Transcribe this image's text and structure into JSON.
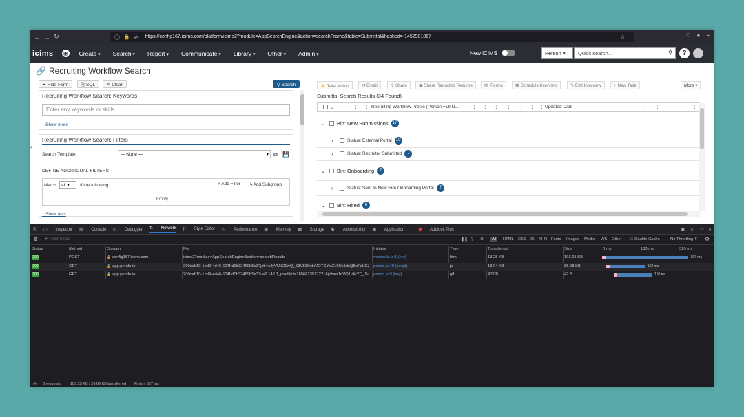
{
  "browser": {
    "url": "https://config167.icims.com/platform/icims2?module=AppSearchEngine&action=searchFrame&table=Submittal&hashed=-1452981867"
  },
  "nav": {
    "logo": "icims",
    "menus": [
      "Create",
      "Search",
      "Report",
      "Communicate",
      "Library",
      "Other",
      "Admin"
    ],
    "new_icims": "New iCIMS",
    "person_select": "Person",
    "quick_search_placeholder": "Quick search...",
    "help": "?"
  },
  "page": {
    "title": "Recruiting Workflow Search"
  },
  "left": {
    "hide_form": "Hide Form",
    "sql": "SQL",
    "clear": "Clear",
    "search": "Search",
    "keywords_title": "Recruiting Workflow Search: Keywords",
    "keywords_placeholder": "Enter any keywords or skills...",
    "show_more": "↓ Show more",
    "filters_title": "Recruiting Workflow Search: Filters",
    "search_template_label": "Search Template",
    "search_template_value": "— None —",
    "define_filters": "DEFINE ADDITIONAL FILTERS",
    "match": "Match",
    "match_value": "all",
    "of_following": "of the following:",
    "add_filter": "Add Filter",
    "add_subgroup": "Add Subgroup",
    "empty": "Empty",
    "show_less": "↑ Show less"
  },
  "right": {
    "toolbar": [
      "Take Action",
      "Email",
      "Share",
      "Share Redacted Resume",
      "iForms",
      "Schedule Interview",
      "Edit Interview",
      "New Task"
    ],
    "more": "More",
    "results_title": "Submittal Search Results (34 Found)",
    "col_profile": "Recruiting Workflow Profile (Person Full N...",
    "col_updated": "Updated Date",
    "bins": [
      {
        "label": "Bin: New Submissions",
        "count": "17"
      },
      {
        "label": "Bin: Onboarding",
        "count": "7"
      },
      {
        "label": "Bin: Hired",
        "count": "6"
      }
    ],
    "statuses": [
      {
        "label": "Status: External Portal",
        "count": "10"
      },
      {
        "label": "Status: Recruiter Submitted",
        "count": "7"
      },
      {
        "label": "Status: Sent to New Hire Onboarding Portal",
        "count": "7"
      }
    ]
  },
  "devtools": {
    "tabs": [
      "Inspector",
      "Console",
      "Debugger",
      "Network",
      "Style Editor",
      "Performance",
      "Memory",
      "Storage",
      "Accessibility",
      "Application",
      "Adblock Plus"
    ],
    "active_tab": "Network",
    "filter_placeholder": "Filter URLs",
    "types": [
      "All",
      "HTML",
      "CSS",
      "JS",
      "XHR",
      "Fonts",
      "Images",
      "Media",
      "WS",
      "Other"
    ],
    "disable_cache": "Disable Cache",
    "throttling": "No Throttling ⬍",
    "columns": [
      "Status",
      "Method",
      "Domain",
      "File",
      "Initiator",
      "Type",
      "Transferred",
      "Size"
    ],
    "timeline": [
      "0 ms",
      "180 ms",
      "320 ms"
    ],
    "rows": [
      {
        "status": "200",
        "method": "POST",
        "domain": "config167.icims.com",
        "file": "icims2?module=AppSearchEngine&action=searchResults",
        "initiator": "mootools.js:1 (xhr)",
        "type": "html",
        "transferred": "13.25 KB",
        "size": "103.21 KB",
        "time": "367 ms",
        "bar_start": 0.0,
        "bar_len": 0.98
      },
      {
        "status": "200",
        "method": "GET",
        "domain": "app.pendo.io",
        "file": "209ceb10-1bd9-4d46-604f-d0b32469b5e3?jzb=eJyVUltO0wQ_S3V836qtnVOTGYeiZ16Us1dsQBsFqLGZd",
        "initiator": "pendo.js:19 (script)",
        "type": "js",
        "transferred": "13.04 KB",
        "size": "85.98 KB",
        "time": "162 ms",
        "bar_start": 0.05,
        "bar_len": 0.44
      },
      {
        "status": "200",
        "method": "GET",
        "domain": "app.pendo.io",
        "file": "209ceb10-1bd9-4d46-604f-d0b32469b5e3?v=2.142.1_prod&ct=1656623517221&jzb=eJzlVQ1v4kYQ_Sus",
        "initiator": "pendo.js:9 (img)",
        "type": "gif",
        "transferred": "407 B",
        "size": "42 B",
        "time": "160 ms",
        "bar_start": 0.13,
        "bar_len": 0.44
      }
    ],
    "summary": {
      "requests": "3 requests",
      "bytes": "189.23 KB / 26.69 KB transferred",
      "finish": "Finish: 367 ms"
    }
  }
}
